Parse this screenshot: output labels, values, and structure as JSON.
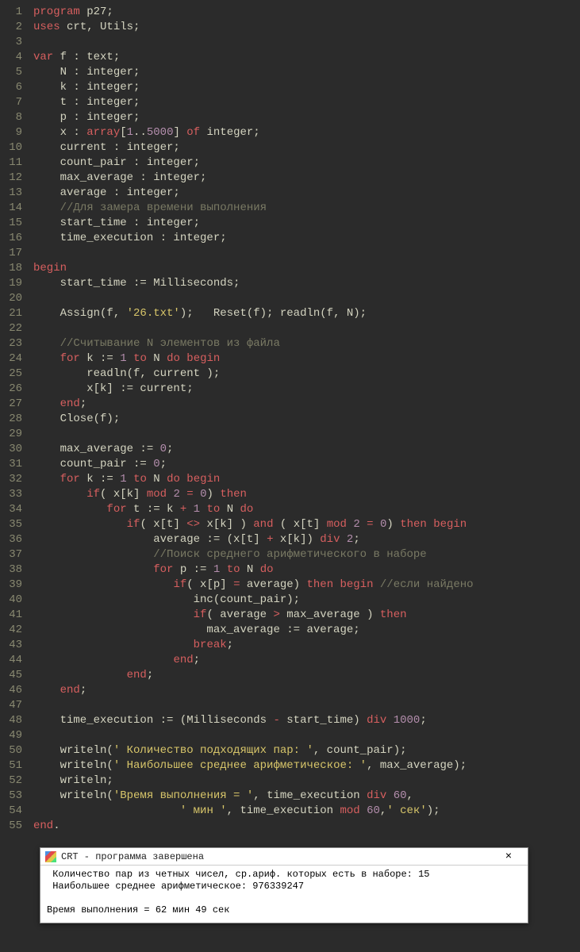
{
  "code_lines": [
    [
      [
        "kw",
        "program"
      ],
      [
        "",
        " p27;"
      ]
    ],
    [
      [
        "kw",
        "uses"
      ],
      [
        "",
        " crt, Utils;"
      ]
    ],
    [
      [
        "",
        ""
      ]
    ],
    [
      [
        "kw",
        "var"
      ],
      [
        "",
        " f : text;"
      ]
    ],
    [
      [
        "",
        "    N : integer;"
      ]
    ],
    [
      [
        "",
        "    k : integer;"
      ]
    ],
    [
      [
        "",
        "    t : integer;"
      ]
    ],
    [
      [
        "",
        "    p : integer;"
      ]
    ],
    [
      [
        "",
        "    x : "
      ],
      [
        "kw",
        "array"
      ],
      [
        "",
        "["
      ],
      [
        "num",
        "1"
      ],
      [
        "",
        "."
      ],
      [
        "",
        "."
      ],
      [
        "num",
        "5000"
      ],
      [
        "",
        "] "
      ],
      [
        "kw",
        "of"
      ],
      [
        "",
        " integer;"
      ]
    ],
    [
      [
        "",
        "    current : integer;"
      ]
    ],
    [
      [
        "",
        "    count_pair : integer;"
      ]
    ],
    [
      [
        "",
        "    max_average : integer;"
      ]
    ],
    [
      [
        "",
        "    average : integer;"
      ]
    ],
    [
      [
        "",
        "    "
      ],
      [
        "cmt",
        "//Для замера времени выполнения"
      ]
    ],
    [
      [
        "",
        "    start_time : integer;"
      ]
    ],
    [
      [
        "",
        "    time_execution : integer;"
      ]
    ],
    [
      [
        "",
        ""
      ]
    ],
    [
      [
        "kw",
        "begin"
      ]
    ],
    [
      [
        "",
        "    start_time := Milliseconds;"
      ]
    ],
    [
      [
        "",
        ""
      ]
    ],
    [
      [
        "",
        "    Assign(f, "
      ],
      [
        "str",
        "'26.txt'"
      ],
      [
        "",
        ");   Reset(f); readln(f, N);"
      ]
    ],
    [
      [
        "",
        ""
      ]
    ],
    [
      [
        "",
        "    "
      ],
      [
        "cmt",
        "//Считывание N элементов из файла"
      ]
    ],
    [
      [
        "",
        "    "
      ],
      [
        "kw",
        "for"
      ],
      [
        "",
        " k := "
      ],
      [
        "num",
        "1"
      ],
      [
        "",
        " "
      ],
      [
        "kw",
        "to"
      ],
      [
        "",
        " N "
      ],
      [
        "kw",
        "do begin"
      ]
    ],
    [
      [
        "",
        "        readln(f, current );"
      ]
    ],
    [
      [
        "",
        "        x[k] := current;"
      ]
    ],
    [
      [
        "",
        "    "
      ],
      [
        "kw",
        "end"
      ],
      [
        "",
        ";"
      ]
    ],
    [
      [
        "",
        "    Close(f);"
      ]
    ],
    [
      [
        "",
        ""
      ]
    ],
    [
      [
        "",
        "    max_average := "
      ],
      [
        "num",
        "0"
      ],
      [
        "",
        ";"
      ]
    ],
    [
      [
        "",
        "    count_pair := "
      ],
      [
        "num",
        "0"
      ],
      [
        "",
        ";"
      ]
    ],
    [
      [
        "",
        "    "
      ],
      [
        "kw",
        "for"
      ],
      [
        "",
        " k := "
      ],
      [
        "num",
        "1"
      ],
      [
        "",
        " "
      ],
      [
        "kw",
        "to"
      ],
      [
        "",
        " N "
      ],
      [
        "kw",
        "do begin"
      ]
    ],
    [
      [
        "",
        "        "
      ],
      [
        "kw",
        "if"
      ],
      [
        "",
        "( x[k] "
      ],
      [
        "kw",
        "mod"
      ],
      [
        "",
        " "
      ],
      [
        "num",
        "2"
      ],
      [
        "",
        " "
      ],
      [
        "op",
        "="
      ],
      [
        "",
        " "
      ],
      [
        "num",
        "0"
      ],
      [
        "",
        ") "
      ],
      [
        "kw",
        "then"
      ]
    ],
    [
      [
        "",
        "           "
      ],
      [
        "kw",
        "for"
      ],
      [
        "",
        " t := k "
      ],
      [
        "op",
        "+"
      ],
      [
        "",
        " "
      ],
      [
        "num",
        "1"
      ],
      [
        "",
        " "
      ],
      [
        "kw",
        "to"
      ],
      [
        "",
        " N "
      ],
      [
        "kw",
        "do"
      ]
    ],
    [
      [
        "",
        "              "
      ],
      [
        "kw",
        "if"
      ],
      [
        "",
        "( x[t] "
      ],
      [
        "op",
        "<>"
      ],
      [
        "",
        " x[k] ) "
      ],
      [
        "kw",
        "and"
      ],
      [
        "",
        " ( x[t] "
      ],
      [
        "kw",
        "mod"
      ],
      [
        "",
        " "
      ],
      [
        "num",
        "2"
      ],
      [
        "",
        " "
      ],
      [
        "op",
        "="
      ],
      [
        "",
        " "
      ],
      [
        "num",
        "0"
      ],
      [
        "",
        ") "
      ],
      [
        "kw",
        "then begin"
      ]
    ],
    [
      [
        "",
        "                  average := (x[t] "
      ],
      [
        "op",
        "+"
      ],
      [
        "",
        " x[k]) "
      ],
      [
        "kw",
        "div"
      ],
      [
        "",
        " "
      ],
      [
        "num",
        "2"
      ],
      [
        "",
        ";"
      ]
    ],
    [
      [
        "",
        "                  "
      ],
      [
        "cmt",
        "//Поиск среднего арифметического в наборе"
      ]
    ],
    [
      [
        "",
        "                  "
      ],
      [
        "kw",
        "for"
      ],
      [
        "",
        " p := "
      ],
      [
        "num",
        "1"
      ],
      [
        "",
        " "
      ],
      [
        "kw",
        "to"
      ],
      [
        "",
        " N "
      ],
      [
        "kw",
        "do"
      ]
    ],
    [
      [
        "",
        "                     "
      ],
      [
        "kw",
        "if"
      ],
      [
        "",
        "( x[p] "
      ],
      [
        "op",
        "="
      ],
      [
        "",
        " average) "
      ],
      [
        "kw",
        "then begin"
      ],
      [
        "",
        " "
      ],
      [
        "cmt",
        "//если найдено"
      ]
    ],
    [
      [
        "",
        "                        inc(count_pair);"
      ]
    ],
    [
      [
        "",
        "                        "
      ],
      [
        "kw",
        "if"
      ],
      [
        "",
        "( average "
      ],
      [
        "op",
        ">"
      ],
      [
        "",
        " max_average ) "
      ],
      [
        "kw",
        "then"
      ]
    ],
    [
      [
        "",
        "                          max_average := average;"
      ]
    ],
    [
      [
        "",
        "                        "
      ],
      [
        "kw",
        "break"
      ],
      [
        "",
        ";"
      ]
    ],
    [
      [
        "",
        "                     "
      ],
      [
        "kw",
        "end"
      ],
      [
        "",
        ";"
      ]
    ],
    [
      [
        "",
        "              "
      ],
      [
        "kw",
        "end"
      ],
      [
        "",
        ";"
      ]
    ],
    [
      [
        "",
        "    "
      ],
      [
        "kw",
        "end"
      ],
      [
        "",
        ";"
      ]
    ],
    [
      [
        "",
        ""
      ]
    ],
    [
      [
        "",
        "    time_execution := (Milliseconds "
      ],
      [
        "op",
        "-"
      ],
      [
        "",
        " start_time) "
      ],
      [
        "kw",
        "div"
      ],
      [
        "",
        " "
      ],
      [
        "num",
        "1000"
      ],
      [
        "",
        ";"
      ]
    ],
    [
      [
        "",
        ""
      ]
    ],
    [
      [
        "",
        "    writeln("
      ],
      [
        "str",
        "' Количество подходящих пар: '"
      ],
      [
        "",
        ", count_pair);"
      ]
    ],
    [
      [
        "",
        "    writeln("
      ],
      [
        "str",
        "' Наибольшее среднее арифметическое: '"
      ],
      [
        "",
        ", max_average);"
      ]
    ],
    [
      [
        "",
        "    writeln;"
      ]
    ],
    [
      [
        "",
        "    writeln("
      ],
      [
        "str",
        "'Время выполнения = '"
      ],
      [
        "",
        ", time_execution "
      ],
      [
        "kw",
        "div"
      ],
      [
        "",
        " "
      ],
      [
        "num",
        "60"
      ],
      [
        "",
        ","
      ]
    ],
    [
      [
        "",
        "                      "
      ],
      [
        "str",
        "' мин '"
      ],
      [
        "",
        ", time_execution "
      ],
      [
        "kw",
        "mod"
      ],
      [
        "",
        " "
      ],
      [
        "num",
        "60"
      ],
      [
        "",
        ","
      ],
      [
        "str",
        "' сек'"
      ],
      [
        "",
        ");"
      ]
    ],
    [
      [
        "kw",
        "end"
      ],
      [
        "",
        "."
      ]
    ]
  ],
  "console": {
    "title": "CRT - программа завершена",
    "lines": [
      " Количество пар из четных чисел, ср.ариф. которых есть в наборе: 15",
      " Наибольшее среднее арифметическое: 976339247",
      "",
      "Время выполнения = 62 мин 49 сек"
    ]
  }
}
